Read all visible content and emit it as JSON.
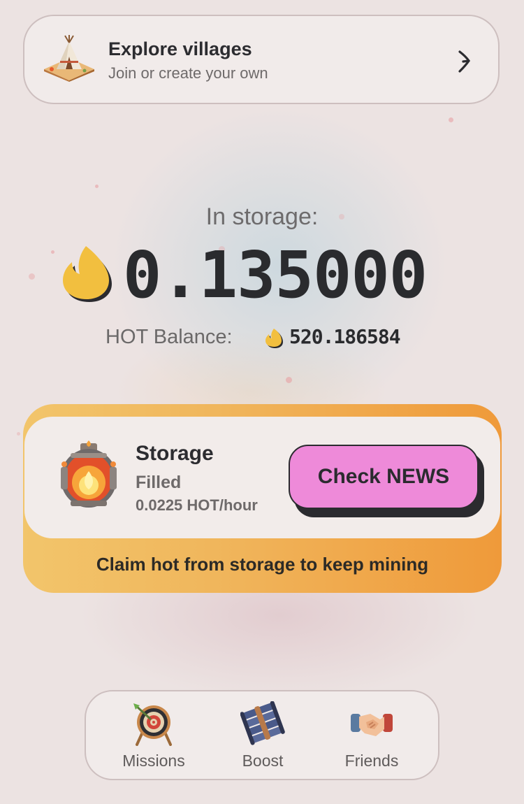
{
  "village_card": {
    "title": "Explore villages",
    "subtitle": "Join or create your own",
    "icon": "teepee-village-icon",
    "arrow_icon": "chevron-right-icon"
  },
  "storage_header": {
    "label": "In storage:",
    "amount": "0.135000",
    "amount_icon": "flame-icon"
  },
  "balance": {
    "label": "HOT Balance:",
    "value": "520.186584",
    "icon": "flame-icon"
  },
  "storage_card": {
    "title": "Storage",
    "status": "Filled",
    "rate": "0.0225 HOT/hour",
    "icon": "storage-furnace-icon",
    "button_label": "Check NEWS",
    "footer": "Claim hot from storage to keep mining"
  },
  "nav": {
    "items": [
      {
        "label": "Missions",
        "icon": "dartboard-icon"
      },
      {
        "label": "Boost",
        "icon": "boost-pipes-icon"
      },
      {
        "label": "Friends",
        "icon": "handshake-icon"
      }
    ]
  },
  "colors": {
    "accent_button": "#ee8ad9",
    "storage_gradient_start": "#f2c56b",
    "storage_gradient_end": "#ef9a3a",
    "flame": "#f2bf3f",
    "text_dark": "#2a2b2e",
    "text_muted": "#6e6a6a"
  }
}
